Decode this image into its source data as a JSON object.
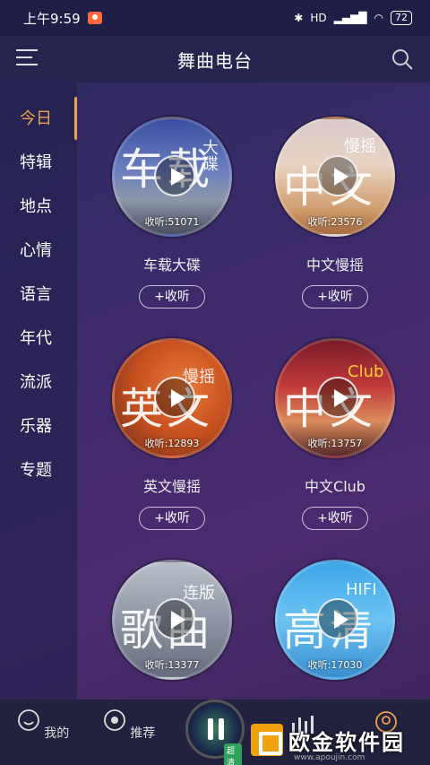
{
  "status": {
    "time": "上午9:59",
    "network": "HD",
    "battery": "72"
  },
  "header": {
    "title": "舞曲电台"
  },
  "sidebar": {
    "items": [
      {
        "label": "今日"
      },
      {
        "label": "特辑"
      },
      {
        "label": "地点"
      },
      {
        "label": "心情"
      },
      {
        "label": "语言"
      },
      {
        "label": "年代"
      },
      {
        "label": "流派"
      },
      {
        "label": "乐器"
      },
      {
        "label": "专题"
      }
    ]
  },
  "cards": [
    {
      "name": "车载大碟",
      "listens": "收听:51071",
      "cover_big": "车载",
      "cover_small": "大碟",
      "button": "+收听"
    },
    {
      "name": "中文慢摇",
      "listens": "收听:23576",
      "cover_big": "中文",
      "cover_small": "慢摇",
      "button": "+收听"
    },
    {
      "name": "英文慢摇",
      "listens": "收听:12893",
      "cover_big": "英文",
      "cover_small": "慢摇",
      "button": "+收听"
    },
    {
      "name": "中文Club",
      "listens": "收听:13757",
      "cover_big": "中文",
      "cover_small": "Club",
      "button": "+收听"
    },
    {
      "name": "",
      "listens": "收听:13377",
      "cover_big": "歌曲",
      "cover_small": "连版",
      "button": ""
    },
    {
      "name": "",
      "listens": "收听:17030",
      "cover_big": "高清",
      "cover_small": "HIFI",
      "button": ""
    }
  ],
  "bottom": {
    "tabs": [
      {
        "label": "我的"
      },
      {
        "label": "推荐"
      }
    ],
    "badge": "超清"
  },
  "watermark": {
    "text": "欧金软件园",
    "url": "www.apoujin.com"
  },
  "colors": {
    "accent": "#f0a24a",
    "bg": "#3a2a6a"
  }
}
